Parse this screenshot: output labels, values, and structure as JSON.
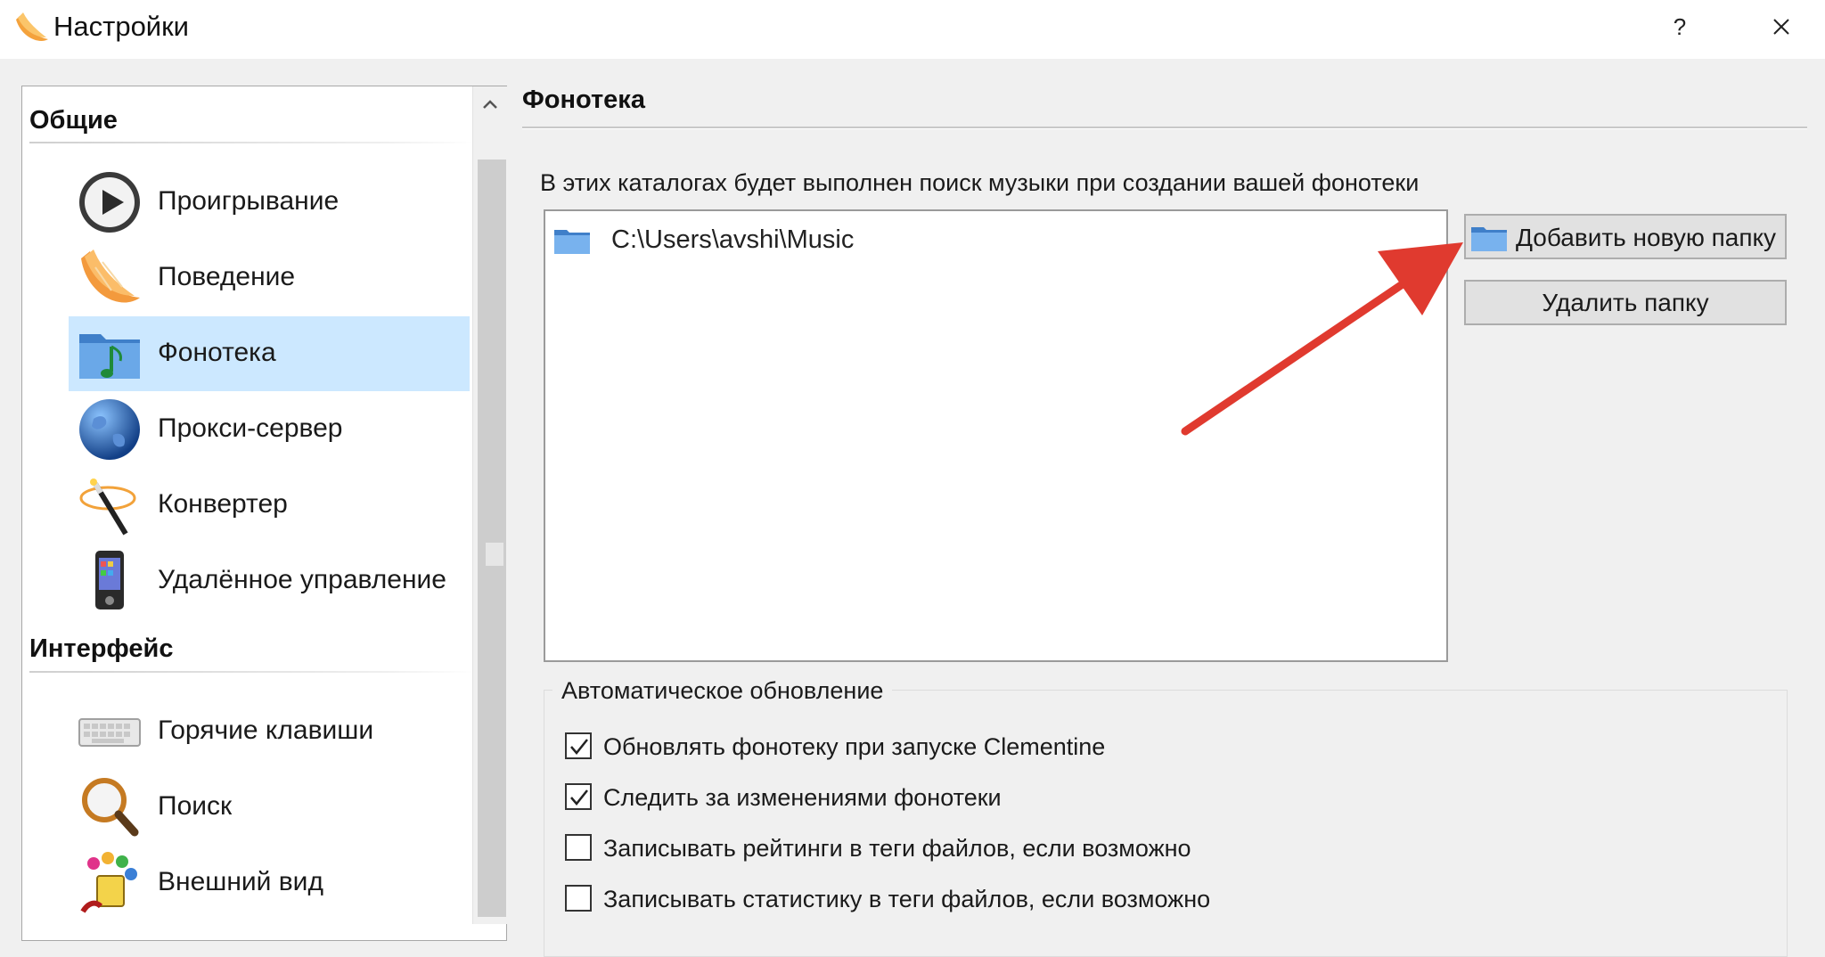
{
  "window": {
    "title": "Настройки",
    "help_label": "?",
    "close_icon": "close-icon"
  },
  "nav": {
    "sections": [
      {
        "title": "Общие",
        "items": [
          {
            "label": "Проигрывание",
            "icon": "play-icon"
          },
          {
            "label": "Поведение",
            "icon": "clementine-icon"
          },
          {
            "label": "Фонотека",
            "icon": "music-folder-icon",
            "selected": true
          },
          {
            "label": "Прокси-сервер",
            "icon": "globe-icon"
          },
          {
            "label": "Конвертер",
            "icon": "magic-wand-icon"
          },
          {
            "label": "Удалённое управление",
            "icon": "phone-icon"
          }
        ]
      },
      {
        "title": "Интерфейс",
        "items": [
          {
            "label": "Горячие клавиши",
            "icon": "keyboard-icon"
          },
          {
            "label": "Поиск",
            "icon": "magnifier-icon"
          },
          {
            "label": "Внешний вид",
            "icon": "paint-icon"
          }
        ]
      }
    ]
  },
  "content": {
    "title": "Фонотека",
    "description": "В этих каталогах будет выполнен поиск музыки при создании вашей фонотеки",
    "folders": [
      "C:\\Users\\avshi\\Music"
    ],
    "buttons": {
      "add": "Добавить новую папку",
      "remove": "Удалить папку"
    },
    "auto_update": {
      "title": "Автоматическое обновление",
      "options": [
        {
          "label": "Обновлять фонотеку при запуске Clementine",
          "checked": true
        },
        {
          "label": "Следить за изменениями фонотеки",
          "checked": true
        },
        {
          "label": "Записывать рейтинги в теги файлов, если возможно",
          "checked": false
        },
        {
          "label": "Записывать статистику в теги файлов, если возможно",
          "checked": false
        }
      ]
    }
  },
  "colors": {
    "selection": "#cce8ff",
    "annotation_arrow": "#e03a2f",
    "folder_blue": "#4a90d9"
  }
}
